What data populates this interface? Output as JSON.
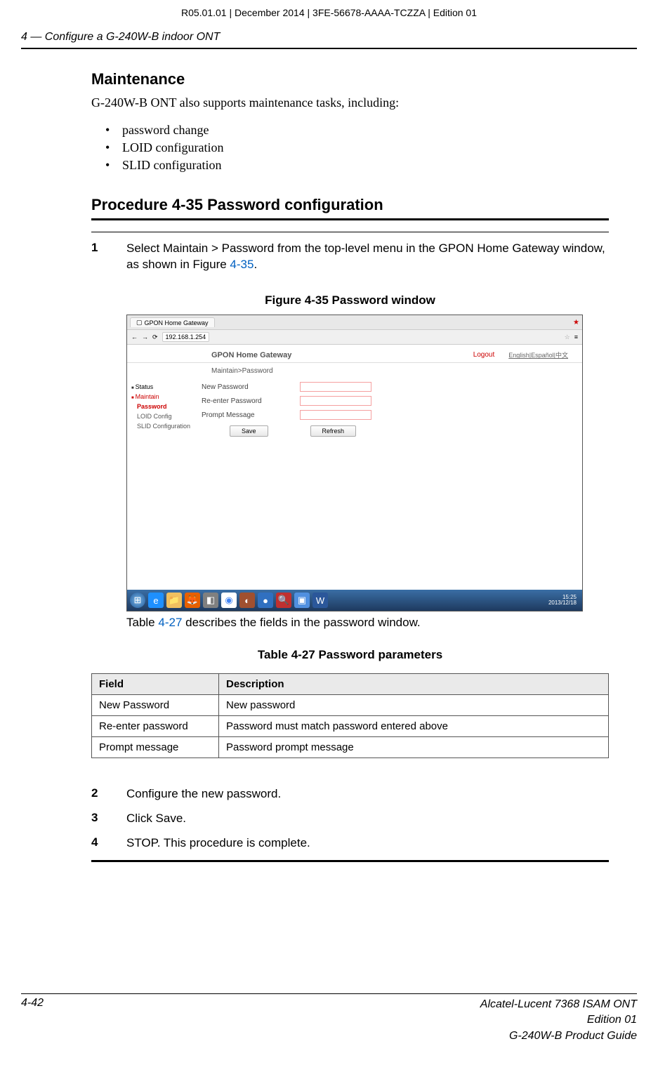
{
  "doc_id": "R05.01.01 | December 2014 | 3FE-56678-AAAA-TCZZA | Edition 01",
  "running_header": "4 —  Configure a G-240W-B indoor ONT",
  "maintenance": {
    "title": "Maintenance",
    "intro": "G-240W-B ONT also supports maintenance tasks, including:",
    "items": [
      "password change",
      "LOID configuration",
      "SLID configuration"
    ]
  },
  "procedure": {
    "title": "Procedure 4-35  Password configuration",
    "step1_num": "1",
    "step1_a": "Select Maintain > Password from the top-level menu in the GPON Home Gateway window, as shown in Figure ",
    "step1_link": "4-35",
    "step1_b": ".",
    "figure_caption": "Figure 4-35  Password window",
    "screenshot": {
      "tab_title": "GPON Home Gateway",
      "url": "192.168.1.254",
      "header_title": "GPON Home Gateway",
      "logout": "Logout",
      "lang": "English|Español|中文",
      "breadcrumb": "Maintain>Password",
      "sidebar": {
        "status": "Status",
        "maintain": "Maintain",
        "password": "Password",
        "loid": "LOID Config",
        "slid": "SLID Configuration"
      },
      "form": {
        "new_password": "New Password",
        "reenter": "Re-enter Password",
        "prompt": "Prompt Message",
        "save": "Save",
        "refresh": "Refresh"
      },
      "clock": {
        "time": "15:25",
        "date": "2013/12/18"
      }
    },
    "after_figure_a": "Table ",
    "after_figure_link": "4-27",
    "after_figure_b": " describes the fields in the password window.",
    "table_caption": "Table 4-27 Password parameters",
    "table": {
      "h1": "Field",
      "h2": "Description",
      "rows": [
        {
          "f": "New Password",
          "d": "New password"
        },
        {
          "f": "Re-enter password",
          "d": "Password must match password entered above"
        },
        {
          "f": "Prompt message",
          "d": "Password prompt message"
        }
      ]
    },
    "step2_num": "2",
    "step2": "Configure the new password.",
    "step3_num": "3",
    "step3": "Click Save.",
    "step4_num": "4",
    "step4": "STOP. This procedure is complete."
  },
  "footer": {
    "page": "4-42",
    "r1": "Alcatel-Lucent 7368 ISAM ONT",
    "r2": "Edition 01",
    "r3": "G-240W-B Product Guide"
  }
}
